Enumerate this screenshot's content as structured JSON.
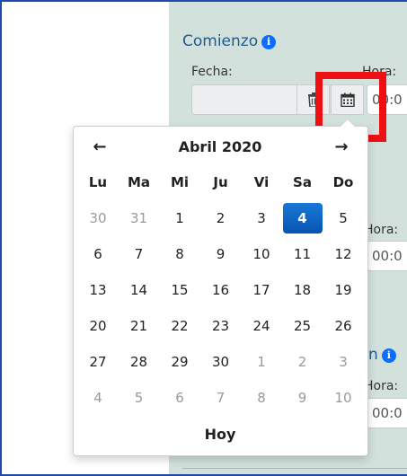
{
  "start_section": {
    "title": "Comienzo",
    "date_label": "Fecha:",
    "time_label": "Hora:",
    "time_value": "00:0"
  },
  "second_section": {
    "time_label": "Hora:",
    "time_value": "00:0"
  },
  "third_section": {
    "title_fragment": "n",
    "time_label": "Hora:",
    "time_value": "00:0"
  },
  "calendar": {
    "prev_label": "←",
    "next_label": "→",
    "month_title": "Abril 2020",
    "weekdays": [
      "Lu",
      "Ma",
      "Mi",
      "Ju",
      "Vi",
      "Sa",
      "Do"
    ],
    "weeks": [
      [
        "30",
        "31",
        "1",
        "2",
        "3",
        "4",
        "5"
      ],
      [
        "6",
        "7",
        "8",
        "9",
        "10",
        "11",
        "12"
      ],
      [
        "13",
        "14",
        "15",
        "16",
        "17",
        "18",
        "19"
      ],
      [
        "20",
        "21",
        "22",
        "23",
        "24",
        "25",
        "26"
      ],
      [
        "27",
        "28",
        "29",
        "30",
        "1",
        "2",
        "3"
      ],
      [
        "4",
        "5",
        "6",
        "7",
        "8",
        "9",
        "10"
      ]
    ],
    "selected_day": "4",
    "today_label": "Hoy"
  },
  "colors": {
    "panel_bg": "#d3e1dd",
    "accent": "#0a64c8",
    "highlight": "#ee0f12",
    "title_color": "#1e5a8a"
  },
  "icons": {
    "info": "info-icon",
    "trash": "trash-icon",
    "calendar": "calendar-icon"
  }
}
